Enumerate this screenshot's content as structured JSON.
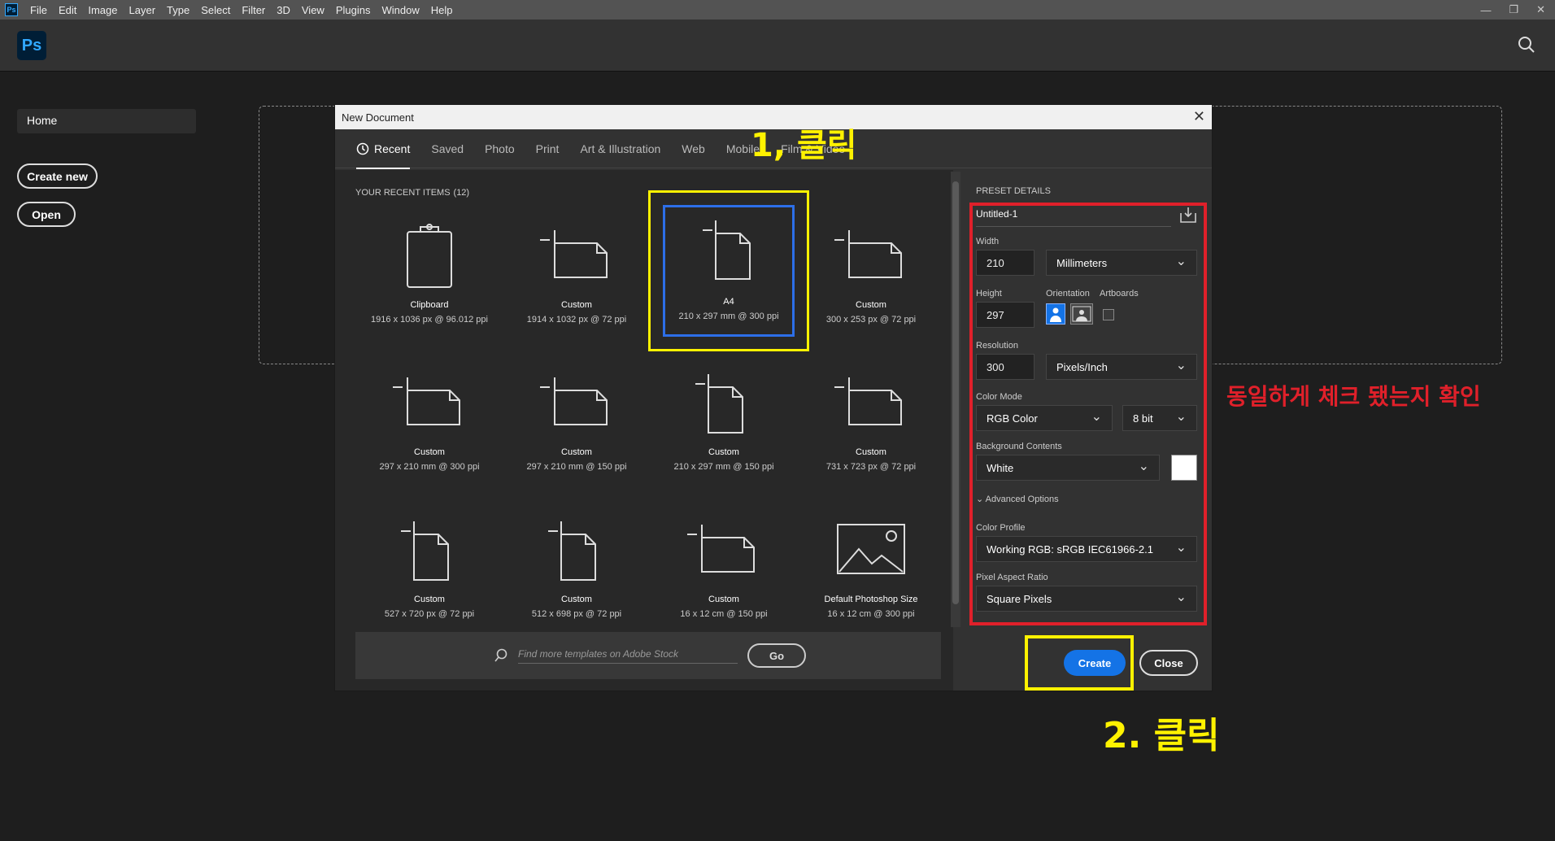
{
  "menubar": {
    "app_badge": "Ps",
    "items": [
      "File",
      "Edit",
      "Image",
      "Layer",
      "Type",
      "Select",
      "Filter",
      "3D",
      "View",
      "Plugins",
      "Window",
      "Help"
    ]
  },
  "topbar": {
    "logo": "Ps"
  },
  "sidebar": {
    "home": "Home",
    "create_new": "Create new",
    "open": "Open"
  },
  "dialog": {
    "title": "New Document",
    "tabs": [
      "Recent",
      "Saved",
      "Photo",
      "Print",
      "Art & Illustration",
      "Web",
      "Mobile",
      "Film & Video"
    ],
    "recent_header": "YOUR RECENT ITEMS",
    "recent_count": "(12)",
    "items": [
      {
        "name": "Clipboard",
        "size": "1916 x 1036 px @ 96.012 ppi",
        "icon": "clipboard-icon"
      },
      {
        "name": "Custom",
        "size": "1914 x 1032 px @ 72 ppi",
        "icon": "landscape-doc-icon"
      },
      {
        "name": "A4",
        "size": "210 x 297 mm @ 300 ppi",
        "icon": "portrait-doc-icon"
      },
      {
        "name": "Custom",
        "size": "300 x 253 px @ 72 ppi",
        "icon": "landscape-doc-icon"
      },
      {
        "name": "Custom",
        "size": "297 x 210 mm @ 300 ppi",
        "icon": "landscape-doc-icon"
      },
      {
        "name": "Custom",
        "size": "297 x 210 mm @ 150 ppi",
        "icon": "landscape-doc-icon"
      },
      {
        "name": "Custom",
        "size": "210 x 297 mm @ 150 ppi",
        "icon": "portrait-doc-icon"
      },
      {
        "name": "Custom",
        "size": "731 x 723 px @ 72 ppi",
        "icon": "landscape-doc-icon"
      },
      {
        "name": "Custom",
        "size": "527 x 720 px @ 72 ppi",
        "icon": "portrait-doc-icon"
      },
      {
        "name": "Custom",
        "size": "512 x 698 px @ 72 ppi",
        "icon": "portrait-doc-icon"
      },
      {
        "name": "Custom",
        "size": "16 x 12 cm @ 150 ppi",
        "icon": "landscape-doc-icon"
      },
      {
        "name": "Default Photoshop Size",
        "size": "16 x 12 cm @ 300 ppi",
        "icon": "image-icon"
      }
    ],
    "stock_placeholder": "Find more templates on Adobe Stock",
    "go": "Go",
    "preset": {
      "header": "PRESET DETAILS",
      "name": "Untitled-1",
      "width_label": "Width",
      "width": "210",
      "width_unit": "Millimeters",
      "height_label": "Height",
      "height": "297",
      "orientation_label": "Orientation",
      "artboards_label": "Artboards",
      "resolution_label": "Resolution",
      "resolution": "300",
      "resolution_unit": "Pixels/Inch",
      "color_mode_label": "Color Mode",
      "color_mode": "RGB Color",
      "bit_depth": "8 bit",
      "bg_label": "Background Contents",
      "bg": "White",
      "advanced": "Advanced Options",
      "profile_label": "Color Profile",
      "profile": "Working RGB: sRGB IEC61966-2.1",
      "par_label": "Pixel Aspect Ratio",
      "par": "Square Pixels"
    },
    "create": "Create",
    "close": "Close"
  },
  "annotations": {
    "step1": "1, 클릭",
    "step2": "2. 클릭",
    "note": "동일하게 체크 됐는지 확인"
  }
}
